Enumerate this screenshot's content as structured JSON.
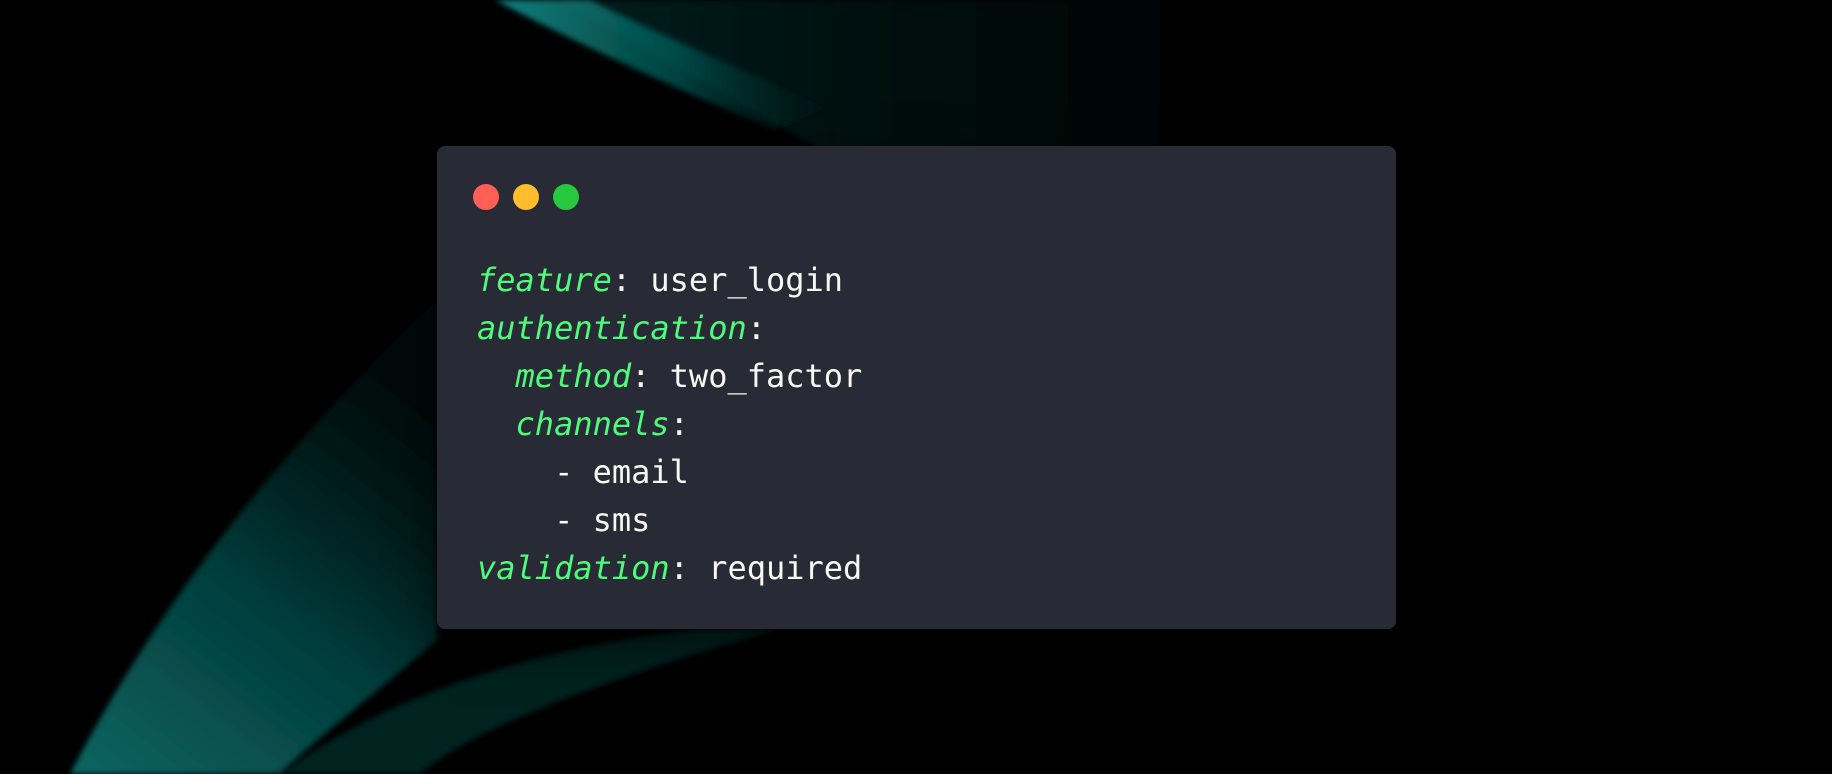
{
  "theme": {
    "background": "#000000",
    "window_background": "#282a36",
    "key_color": "#50fa7b",
    "text_color": "#f8f8f2",
    "wave_color": "#0a6a68"
  },
  "window": {
    "controls": [
      {
        "name": "close",
        "color": "#ff5f56"
      },
      {
        "name": "minimize",
        "color": "#ffbd2e"
      },
      {
        "name": "maximize",
        "color": "#27c93f"
      }
    ]
  },
  "code": {
    "language": "yaml",
    "lines": [
      {
        "indent": "",
        "key": "feature",
        "sep": ":",
        "value": " user_login"
      },
      {
        "indent": "",
        "key": "authentication",
        "sep": ":",
        "value": ""
      },
      {
        "indent": "  ",
        "key": "method",
        "sep": ":",
        "value": " two_factor"
      },
      {
        "indent": "  ",
        "key": "channels",
        "sep": ":",
        "value": ""
      },
      {
        "indent": "    ",
        "key": "",
        "sep": "",
        "value": "- email"
      },
      {
        "indent": "    ",
        "key": "",
        "sep": "",
        "value": "- sms"
      },
      {
        "indent": "",
        "key": "validation",
        "sep": ":",
        "value": " required"
      }
    ]
  }
}
